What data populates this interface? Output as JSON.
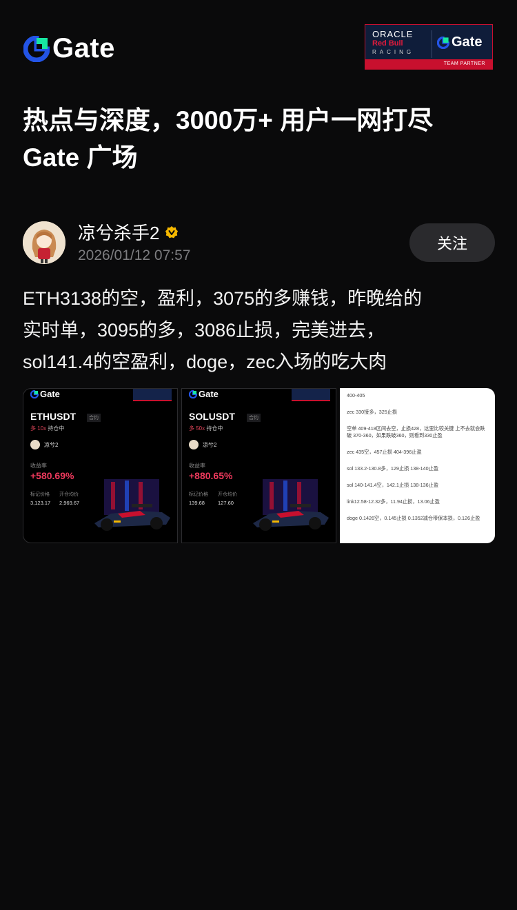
{
  "header": {
    "brand": "Gate",
    "partner_line1": "ORACLE",
    "partner_line2": "Red Bull",
    "partner_line3": "RACING",
    "partner_brand": "Gate",
    "partner_tag": "TEAM PARTNER"
  },
  "headline": {
    "line1": "热点与深度，3000万+ 用户一网打尽",
    "line2": "Gate 广场"
  },
  "post": {
    "username": "凉兮杀手2",
    "timestamp": "2026/01/12 07:57",
    "follow_label": "关注",
    "text_line1": "ETH3138的空，盈利，3075的多赚钱，昨晚给的",
    "text_line2": "实时单，3095的多，3086止损，完美进去，",
    "text_line3": "sol141.4的空盈利，doge，zec入场的吃大肉"
  },
  "images": [
    {
      "brand": "Gate",
      "pair": "ETHUSDT",
      "tag": "合约",
      "leverage": "多 10x",
      "status": "持仓中",
      "user": "凉兮2",
      "roi_label": "收益率",
      "roi": "+580.69%",
      "mark_label": "标记价格",
      "entry_label": "开仓均价",
      "mark": "3,123.17",
      "entry": "2,969.67"
    },
    {
      "brand": "Gate",
      "pair": "SOLUSDT",
      "tag": "合约",
      "leverage": "多 50x",
      "status": "持仓中",
      "user": "凉兮2",
      "roi_label": "收益率",
      "roi": "+880.65%",
      "mark_label": "标记价格",
      "entry_label": "开仓均价",
      "mark": "139.68",
      "entry": "127.60"
    }
  ],
  "notes": [
    "400-405",
    "zec 330接多，325止损",
    "空单 409-418区间去空，止损428，这里比较关键 上不去就会跌破 370-360，如果跌破360，则看到330止盈",
    "zec 435空，457止损 404-396止盈",
    "sol 133.2-130.8多，129止损 138-140止盈",
    "sol 140-141.4空，142.1止损 138-136止盈",
    "link12.58-12.32多，11.94止损，13.06止盈",
    "doge 0.1426空，0.145止损 0.1352减仓带保本损，0.126止盈"
  ],
  "colors": {
    "background": "#0a0a0b",
    "gate_blue": "#2354e6",
    "gate_green": "#17e6a1",
    "verified_gold": "#f5b800",
    "profit_red": "#ef3a5d"
  }
}
